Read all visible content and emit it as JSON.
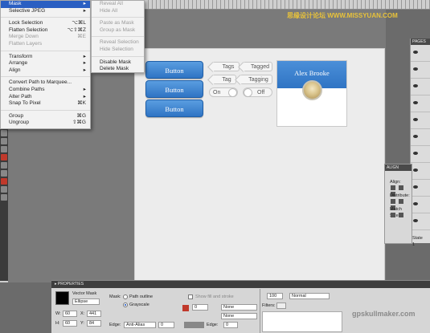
{
  "menu": {
    "items": [
      {
        "label": "Mask",
        "shortcut": "▸",
        "state": "highlight"
      },
      {
        "label": "Selective JPEG",
        "shortcut": "▸",
        "state": "normal"
      },
      {
        "label": "",
        "shortcut": "",
        "state": "sep"
      },
      {
        "label": "Lock Selection",
        "shortcut": "⌥⌘L",
        "state": "normal"
      },
      {
        "label": "Flatten Selection",
        "shortcut": "⌥⇧⌘Z",
        "state": "normal"
      },
      {
        "label": "Merge Down",
        "shortcut": "⌘E",
        "state": "disabled"
      },
      {
        "label": "Flatten Layers",
        "shortcut": "",
        "state": "disabled"
      },
      {
        "label": "",
        "shortcut": "",
        "state": "sep"
      },
      {
        "label": "Transform",
        "shortcut": "▸",
        "state": "normal"
      },
      {
        "label": "Arrange",
        "shortcut": "▸",
        "state": "normal"
      },
      {
        "label": "Align",
        "shortcut": "▸",
        "state": "normal"
      },
      {
        "label": "",
        "shortcut": "",
        "state": "sep"
      },
      {
        "label": "Convert Path to Marquee...",
        "shortcut": "",
        "state": "normal"
      },
      {
        "label": "Combine Paths",
        "shortcut": "▸",
        "state": "normal"
      },
      {
        "label": "Alter Path",
        "shortcut": "▸",
        "state": "normal"
      },
      {
        "label": "Snap To Pixel",
        "shortcut": "⌘K",
        "state": "normal"
      },
      {
        "label": "",
        "shortcut": "",
        "state": "sep"
      },
      {
        "label": "Group",
        "shortcut": "⌘G",
        "state": "normal"
      },
      {
        "label": "Ungroup",
        "shortcut": "⇧⌘G",
        "state": "normal"
      }
    ]
  },
  "submenu": {
    "items": [
      {
        "label": "Reveal All",
        "state": "disabled"
      },
      {
        "label": "Hide All",
        "state": "disabled"
      },
      {
        "label": "",
        "state": "sep"
      },
      {
        "label": "Paste as Mask",
        "state": "disabled"
      },
      {
        "label": "Group as Mask",
        "state": "disabled"
      },
      {
        "label": "",
        "state": "sep"
      },
      {
        "label": "Reveal Selection",
        "state": "disabled"
      },
      {
        "label": "Hide Selection",
        "state": "disabled"
      },
      {
        "label": "",
        "state": "sep"
      },
      {
        "label": "Disable Mask",
        "state": "normal"
      },
      {
        "label": "Delete Mask",
        "state": "normal"
      }
    ]
  },
  "canvas": {
    "buttons": [
      "Button",
      "Button",
      "Button"
    ],
    "tags": [
      "Tags",
      "Tagged",
      "Tag",
      "Tagging"
    ],
    "toggle_on": "On",
    "toggle_off": "Off",
    "profile_name": "Alex Brooke",
    "accent": "#2f74c4"
  },
  "watermark": "思缘设计论坛 WWW.MISSYUAN.COM",
  "watermark2": "gpskullmaker.com",
  "pages_panel": {
    "title": "PAGES"
  },
  "align_panel": {
    "title": "ALIGN",
    "align_label": "Align:",
    "distribute_label": "Distribute:",
    "match_label": "Match Size:",
    "state": "State 1"
  },
  "properties": {
    "title": "▸ PROPERTIES",
    "object_type": "Vector Mask",
    "object_name": "Ellipse",
    "mask_label": "Mask:",
    "mask_options": [
      "Path outline",
      "Grayscale"
    ],
    "w_label": "W:",
    "w": "60",
    "x_label": "X:",
    "x": "441",
    "h_label": "H:",
    "h": "60",
    "y_label": "Y:",
    "y": "84",
    "edge_label": "Edge:",
    "edge_value": "Anti-Alias",
    "edge_num": "0",
    "show_fill": "Show fill and stroke",
    "opacity": "100",
    "blend": "Normal",
    "stroke_num": "0",
    "stroke_none": "None",
    "edge2_label": "Edge:",
    "edge2_num": "0",
    "filters_label": "Filters:",
    "fill_none": "None"
  }
}
